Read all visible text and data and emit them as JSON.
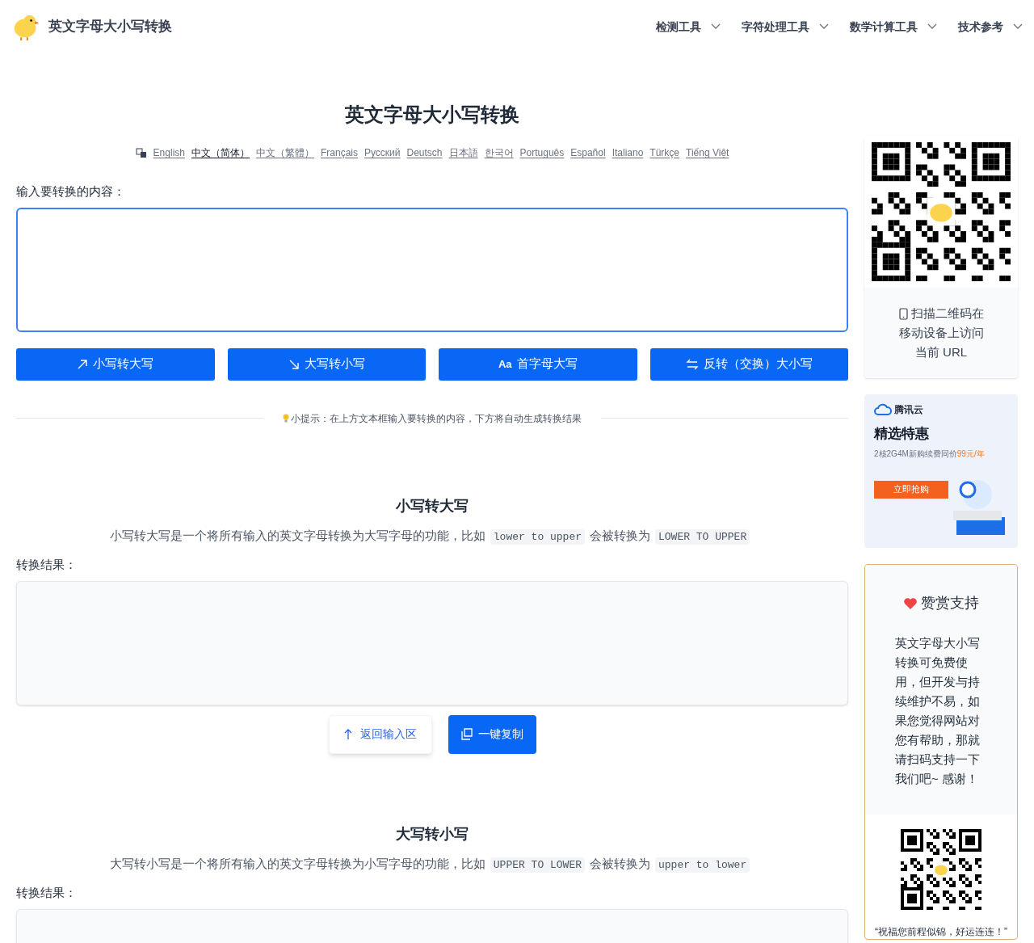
{
  "header": {
    "site_title": "英文字母大小写转换",
    "nav": [
      {
        "label": "检测工具"
      },
      {
        "label": "字符处理工具"
      },
      {
        "label": "数学计算工具"
      },
      {
        "label": "技术参考"
      }
    ]
  },
  "page_title": "英文字母大小写转换",
  "languages": [
    {
      "label": "English",
      "selected": false
    },
    {
      "label": "中文（简体）",
      "selected": true
    },
    {
      "label": "中文（繁體）",
      "selected": false
    },
    {
      "label": "Français",
      "selected": false
    },
    {
      "label": "Русский",
      "selected": false
    },
    {
      "label": "Deutsch",
      "selected": false
    },
    {
      "label": "日本語",
      "selected": false
    },
    {
      "label": "한국어",
      "selected": false
    },
    {
      "label": "Português",
      "selected": false
    },
    {
      "label": "Español",
      "selected": false
    },
    {
      "label": "Italiano",
      "selected": false
    },
    {
      "label": "Türkçe",
      "selected": false
    },
    {
      "label": "Tiếng Việt",
      "selected": false
    }
  ],
  "input": {
    "label": "输入要转换的内容："
  },
  "convert_buttons": [
    {
      "kind": "up",
      "label": "小写转大写"
    },
    {
      "kind": "down",
      "label": "大写转小写"
    },
    {
      "kind": "aa",
      "icon_text": "Aa",
      "label": "首字母大写"
    },
    {
      "kind": "swap",
      "label": "反转（交换）大小写"
    }
  ],
  "hint": "小提示：在上方文本框输入要转换的内容，下方将自动生成转换结果",
  "sections": [
    {
      "title": "小写转大写",
      "description": [
        {
          "kind": "text",
          "text": "小写转大写是一个将所有输入的英文字母转换为大写字母的功能，比如"
        },
        {
          "kind": "code",
          "text": "lower to upper"
        },
        {
          "kind": "text",
          "text": "会被转换为"
        },
        {
          "kind": "code",
          "text": "LOWER TO UPPER"
        }
      ],
      "result_label": "转换结果：",
      "actions": [
        {
          "kind": "back",
          "label": "返回输入区"
        },
        {
          "kind": "copy",
          "label": "一键复制"
        }
      ]
    },
    {
      "title": "大写转小写",
      "description": [
        {
          "kind": "text",
          "text": "大写转小写是一个将所有输入的英文字母转换为小写字母的功能，比如"
        },
        {
          "kind": "code",
          "text": "UPPER TO LOWER"
        },
        {
          "kind": "text",
          "text": "会被转换为"
        },
        {
          "kind": "code",
          "text": "upper to lower"
        }
      ],
      "result_label": "转换结果："
    }
  ],
  "sidebar": {
    "qr_caption": [
      "扫描二维码在",
      "移动设备上访问",
      "当前 URL"
    ],
    "ad": {
      "brand": "腾讯云",
      "headline": "精选特惠",
      "offer": "2核2G4M新购续费同价",
      "price": "99元/年",
      "cta": "立即抢购"
    },
    "support": {
      "title": "赞赏支持",
      "text": "英文字母大小写转换可免费使用，但开发与持续维护不易，如果您觉得网站对您有帮助，那就请扫码支持一下我们吧~ 感谢！",
      "blessing": "“祝福您前程似锦，好运连连！”"
    }
  }
}
